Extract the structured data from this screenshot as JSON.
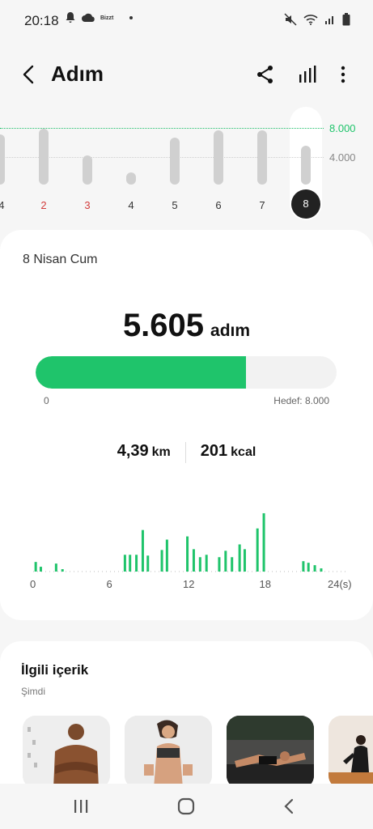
{
  "status_bar": {
    "time": "20:18",
    "mini_label": "Bizzt"
  },
  "app_bar": {
    "title": "Adım"
  },
  "week_chart": {
    "goal_label": "8.000",
    "mid_label": "4.000",
    "days": [
      {
        "label": "/4",
        "steps": 7200,
        "weekend": false
      },
      {
        "label": "2",
        "steps": 8000,
        "weekend": true
      },
      {
        "label": "3",
        "steps": 4200,
        "weekend": true
      },
      {
        "label": "4",
        "steps": 1800,
        "weekend": false
      },
      {
        "label": "5",
        "steps": 6800,
        "weekend": false
      },
      {
        "label": "6",
        "steps": 7800,
        "weekend": false
      },
      {
        "label": "7",
        "steps": 7800,
        "weekend": false
      },
      {
        "label": "8",
        "steps": 5605,
        "weekend": false
      }
    ],
    "goal": 8000,
    "selected_day": "8"
  },
  "summary": {
    "date": "8 Nisan Cum",
    "steps": "5.605",
    "steps_unit": "adım",
    "progress_min": "0",
    "progress_goal": "Hedef: 8.000",
    "progress_fraction": 0.7,
    "distance": "4,39",
    "distance_unit": "km",
    "calories": "201",
    "calories_unit": "kcal"
  },
  "chart_data": {
    "type": "bar",
    "x_ticks": [
      "0",
      "6",
      "12",
      "18",
      "24(s)"
    ],
    "xlim": [
      0,
      24
    ],
    "bars": [
      {
        "x": 0.2,
        "v": 12
      },
      {
        "x": 0.6,
        "v": 6
      },
      {
        "x": 1.8,
        "v": 10
      },
      {
        "x": 2.3,
        "v": 3
      },
      {
        "x": 7.2,
        "v": 21
      },
      {
        "x": 7.6,
        "v": 21
      },
      {
        "x": 8.1,
        "v": 21
      },
      {
        "x": 8.6,
        "v": 52
      },
      {
        "x": 9.0,
        "v": 20
      },
      {
        "x": 10.1,
        "v": 27
      },
      {
        "x": 10.5,
        "v": 40
      },
      {
        "x": 12.1,
        "v": 44
      },
      {
        "x": 12.6,
        "v": 28
      },
      {
        "x": 13.1,
        "v": 18
      },
      {
        "x": 13.6,
        "v": 21
      },
      {
        "x": 14.6,
        "v": 18
      },
      {
        "x": 15.1,
        "v": 26
      },
      {
        "x": 15.6,
        "v": 18
      },
      {
        "x": 16.2,
        "v": 34
      },
      {
        "x": 16.6,
        "v": 28
      },
      {
        "x": 17.6,
        "v": 54
      },
      {
        "x": 18.1,
        "v": 73
      },
      {
        "x": 21.2,
        "v": 13
      },
      {
        "x": 21.6,
        "v": 11
      },
      {
        "x": 22.1,
        "v": 8
      },
      {
        "x": 22.6,
        "v": 4
      }
    ]
  },
  "related": {
    "title": "İlgili içerik",
    "subtitle": "Şimdi"
  },
  "colors": {
    "accent": "#1fc46b",
    "inactive_bar": "#d0d0d0",
    "weekend": "#d23b3b"
  }
}
